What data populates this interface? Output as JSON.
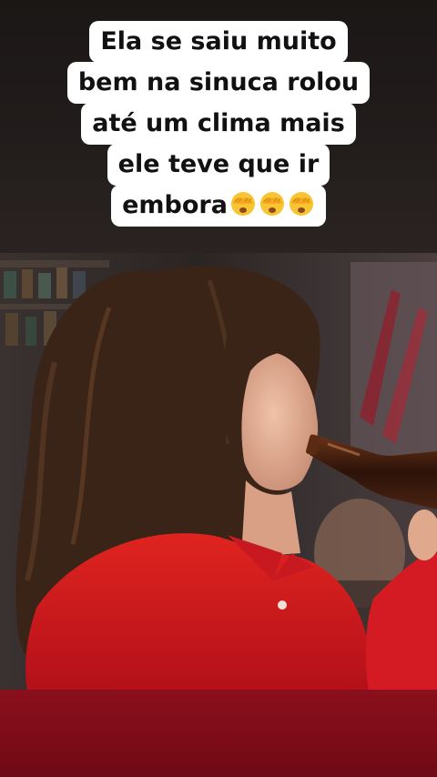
{
  "caption": {
    "lines": [
      "Ela se saiu muito",
      "bem na sinuca rolou",
      "até um clima mais",
      "ele teve que ir",
      "embora"
    ],
    "emojis": [
      "face-with-hand-over-eyes-emoji",
      "face-with-hand-over-eyes-emoji",
      "face-with-hand-over-eyes-emoji"
    ]
  },
  "scene": {
    "subject": "woman-drinking-from-bottle",
    "colors": {
      "top_band": "#221d1c",
      "bottom_band": "#7c0c18",
      "shirt": "#d3141c",
      "hair": "#3a2418",
      "bottle": "#3b1a0e"
    }
  }
}
